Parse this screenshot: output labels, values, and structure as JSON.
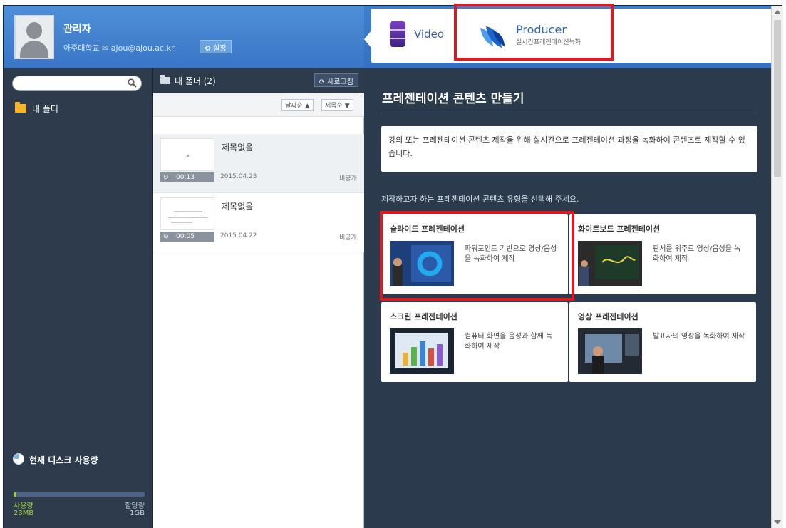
{
  "profile": {
    "name": "관리자",
    "org": "아주대학교 ✉ ajou@ajou.ac.kr",
    "settings_label": "⚙ 설정"
  },
  "tabs": [
    {
      "label": "Video"
    },
    {
      "label": "Producer",
      "sub": "실시간프레젠테이션녹화"
    }
  ],
  "sidebar": {
    "search": {
      "placeholder": "",
      "value": ""
    },
    "my_folder_label": "내 폴더"
  },
  "disk": {
    "title": "현재 디스크 사용량",
    "used_label": "사용량",
    "used_value": "23MB",
    "total_label": "할당량",
    "total_value": "1GB",
    "used_fraction": 0.02
  },
  "folder_panel": {
    "title": "내 폴더 (2)",
    "refresh_label": "⟳ 새로고침",
    "sort_date_label": "날짜순 ▲",
    "sort_title_label": "제목순 ▼",
    "items": [
      {
        "title": "제목없음",
        "duration": "00:13",
        "date": "2015.04.23",
        "visibility": "비공개"
      },
      {
        "title": "제목없음",
        "duration": "00:05",
        "date": "2015.04.22",
        "visibility": "비공개"
      }
    ]
  },
  "content": {
    "heading": "프레젠테이션 콘텐츠 만들기",
    "description": "강의 또는 프레젠테이션 콘텐츠 제작을 위해 실시간으로 프레젠테이션 과정을 녹화하여 콘텐츠로 제작할 수 있습니다.",
    "prompt": "제작하고자 하는 프레젠테이션 콘텐츠 유형을 선택해 주세요.",
    "cards": [
      {
        "title": "슬라이드 프레젠테이션",
        "desc": "파워포인트 기반으로 영상/음성을 녹화하여 제작"
      },
      {
        "title": "화이트보드 프레젠테이션",
        "desc": "판서를 위주로 영상/음성을 녹화하여 제작"
      },
      {
        "title": "스크린 프레젠테이션",
        "desc": "컴퓨터 화면을 음성과 함께 녹화하여 제작"
      },
      {
        "title": "영상 프레젠테이션",
        "desc": "발표자의 영상을 녹화하여 제작"
      }
    ]
  },
  "colors": {
    "highlight": "#e01822",
    "header_blue": "#3a76c6",
    "panel_dark": "#2b3a4d"
  }
}
